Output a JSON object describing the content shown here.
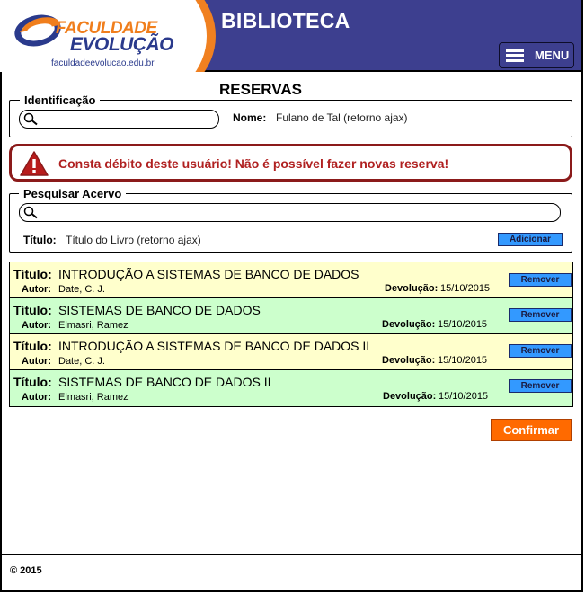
{
  "header": {
    "logo_line1": "FACULDADE",
    "logo_line2": "EVOLUÇÃO",
    "logo_url": "faculdadeevolucao.edu.br",
    "app_title": "BIBLIOTECA",
    "menu_label": "MENU"
  },
  "page_title": "RESERVAS",
  "identificacao": {
    "legend": "Identificação",
    "search_value": "",
    "nome_label": "Nome:",
    "nome_value": "Fulano de Tal (retorno ajax)"
  },
  "alert": {
    "message": "Consta débito deste usuário! Não é possível fazer novas reserva!",
    "color": "#8b1a1a"
  },
  "acervo": {
    "legend": "Pesquisar Acervo",
    "search_value": "",
    "titulo_label": "Título:",
    "titulo_value": "Título do Livro (retorno ajax)",
    "add_label": "Adicionar"
  },
  "reservas": {
    "titulo_label": "Título:",
    "autor_label": "Autor:",
    "devolucao_label": "Devolução:",
    "remove_label": "Remover",
    "items": [
      {
        "titulo": "INTRODUÇÃO A SISTEMAS DE BANCO DE DADOS",
        "autor": "Date, C. J.",
        "devolucao": "15/10/2015",
        "color": "yellow"
      },
      {
        "titulo": "SISTEMAS DE BANCO DE DADOS",
        "autor": "Elmasri, Ramez",
        "devolucao": "15/10/2015",
        "color": "green"
      },
      {
        "titulo": "INTRODUÇÃO A SISTEMAS DE BANCO DE DADOS II",
        "autor": "Date, C. J.",
        "devolucao": "15/10/2015",
        "color": "yellow"
      },
      {
        "titulo": "SISTEMAS DE BANCO DE DADOS II",
        "autor": "Elmasri, Ramez",
        "devolucao": "15/10/2015",
        "color": "green"
      }
    ]
  },
  "confirm_label": "Confirmar",
  "footer": {
    "text": "© 2015"
  },
  "colors": {
    "header_bg": "#3d3f8f",
    "accent_orange": "#ff6a00",
    "button_blue": "#3399ff",
    "row_yellow": "#ffffcc",
    "row_green": "#ccffcc"
  }
}
